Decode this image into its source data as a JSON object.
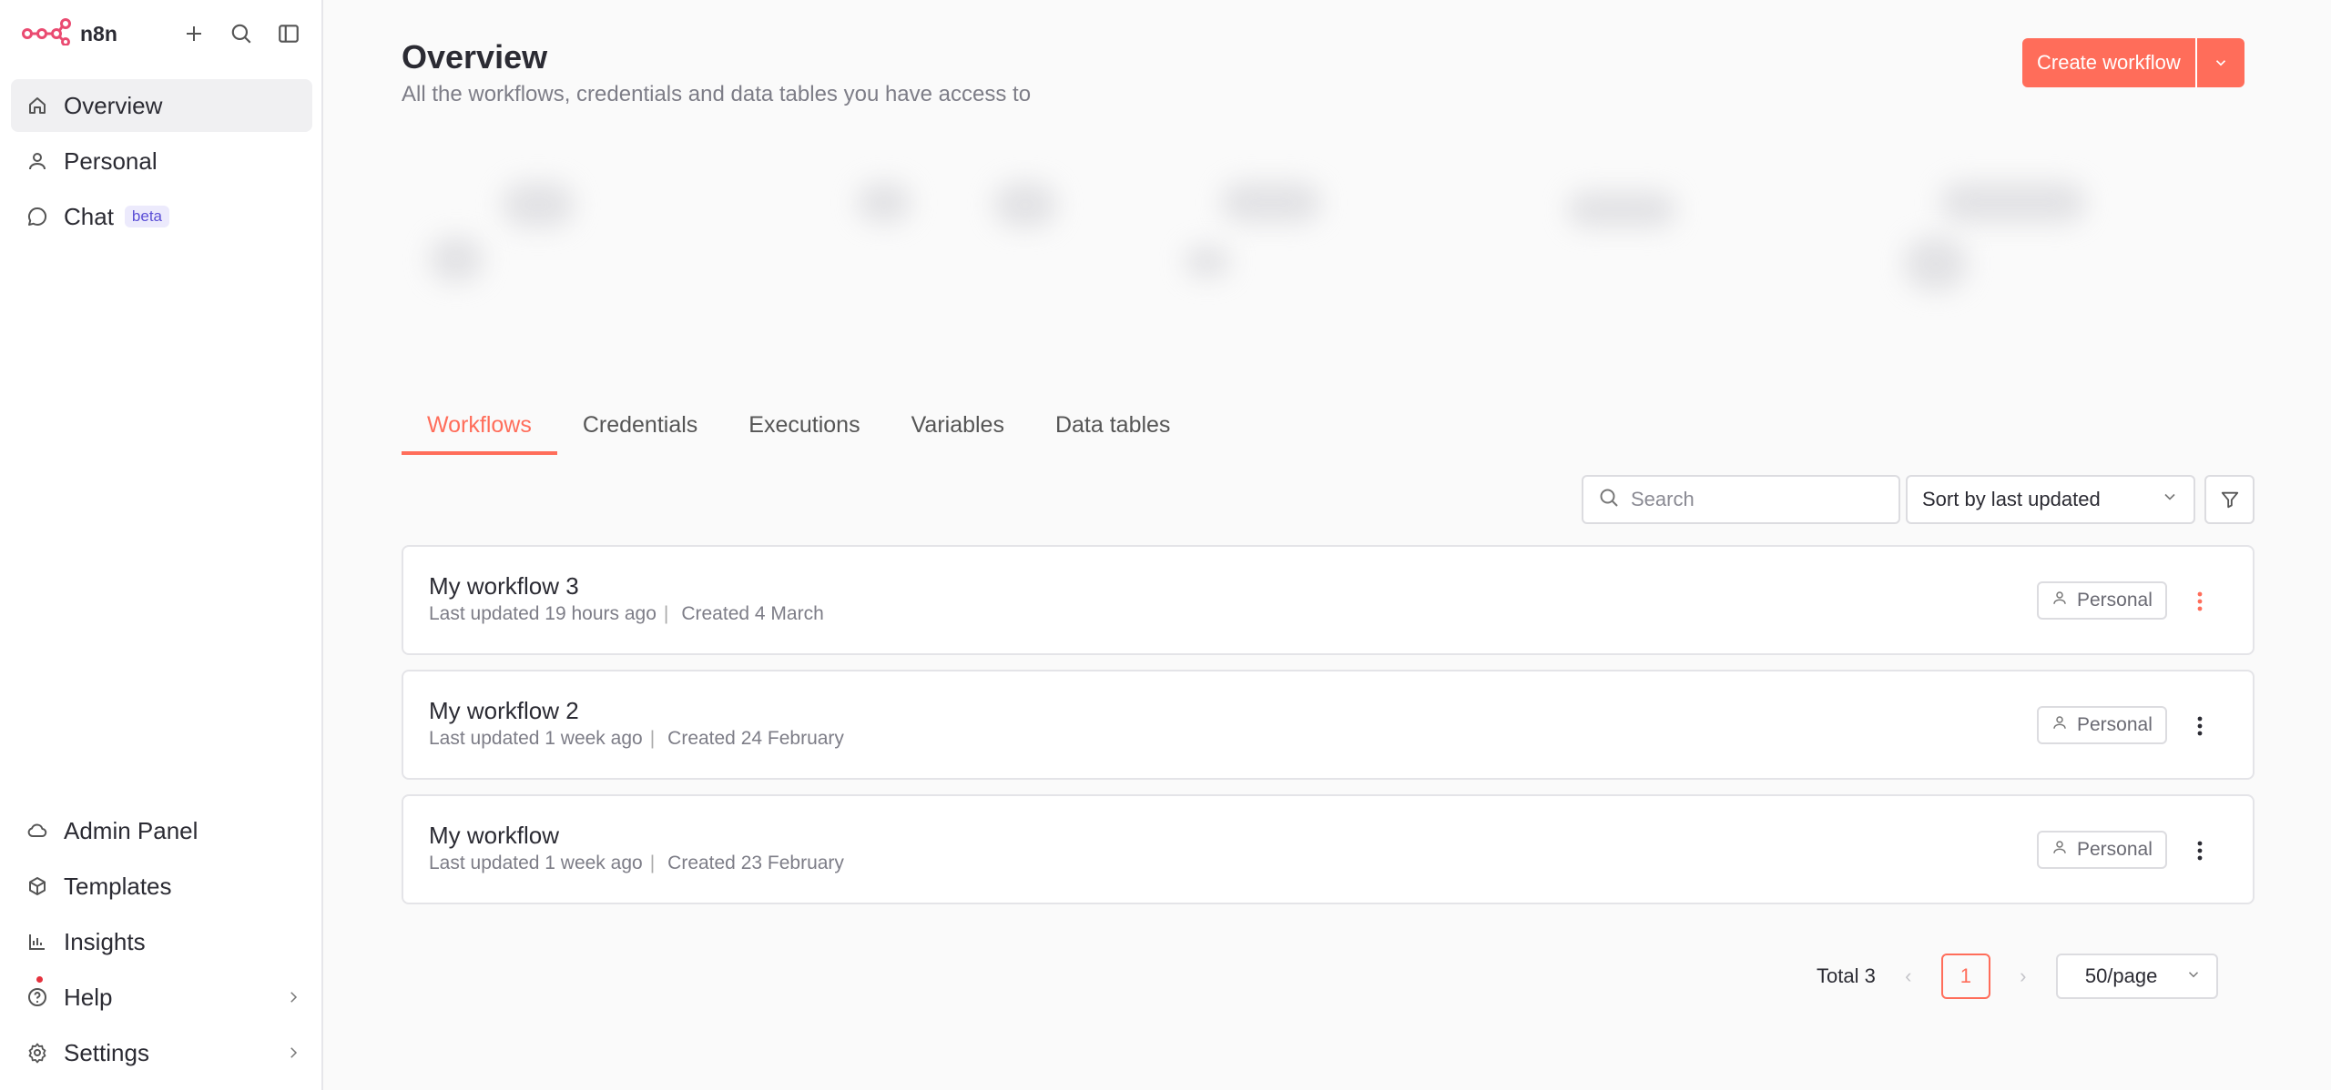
{
  "app": {
    "brand": "n8n"
  },
  "sidebar": {
    "items": [
      {
        "label": "Overview",
        "icon": "home-icon"
      },
      {
        "label": "Personal",
        "icon": "user-icon"
      },
      {
        "label": "Chat",
        "icon": "chat-icon",
        "badge": "beta"
      }
    ],
    "bottom_items": [
      {
        "label": "Admin Panel",
        "icon": "cloud-icon"
      },
      {
        "label": "Templates",
        "icon": "box-icon"
      },
      {
        "label": "Insights",
        "icon": "bar-chart-icon"
      },
      {
        "label": "Help",
        "icon": "help-icon"
      },
      {
        "label": "Settings",
        "icon": "gear-icon"
      }
    ]
  },
  "header": {
    "title": "Overview",
    "subtitle": "All the workflows, credentials and data tables you have access to",
    "create_label": "Create workflow"
  },
  "tabs": [
    "Workflows",
    "Credentials",
    "Executions",
    "Variables",
    "Data tables"
  ],
  "toolbar": {
    "search_placeholder": "Search",
    "sort_label": "Sort by last updated"
  },
  "workflows": [
    {
      "name": "My workflow 3",
      "updated": "Last updated 19 hours ago",
      "created": "Created 4 March",
      "owner": "Personal"
    },
    {
      "name": "My workflow 2",
      "updated": "Last updated 1 week ago",
      "created": "Created 24 February",
      "owner": "Personal"
    },
    {
      "name": "My workflow",
      "updated": "Last updated 1 week ago",
      "created": "Created 23 February",
      "owner": "Personal"
    }
  ],
  "pagination": {
    "total": "Total 3",
    "page": "1",
    "per_page": "50/page"
  },
  "colors": {
    "accent": "#ff6d5a",
    "brand_logo": "#ea4b71"
  }
}
